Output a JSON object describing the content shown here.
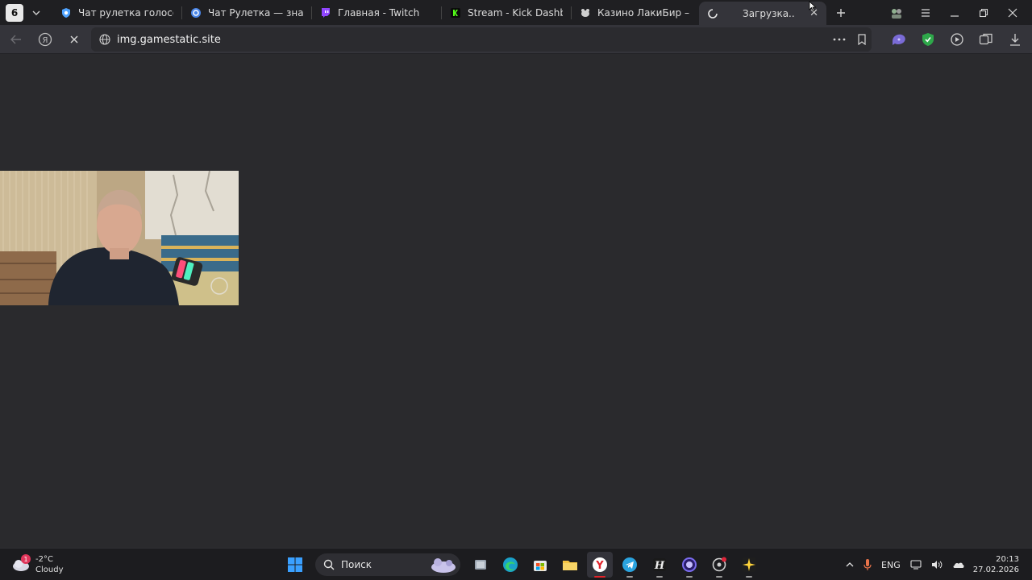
{
  "browser": {
    "tab_count": "6",
    "tabs": [
      {
        "title": "Чат рулетка голосовая -",
        "icon": "roulette-shield-icon",
        "color": "#4fa3ff"
      },
      {
        "title": "Чат Рулетка — знакомст",
        "icon": "roulette-gear-icon",
        "color": "#6aa6ff"
      },
      {
        "title": "Главная - Twitch",
        "icon": "twitch-icon",
        "color": "#9146ff"
      },
      {
        "title": "Stream - Kick Dashboard",
        "icon": "kick-icon",
        "color": "#53fc18"
      },
      {
        "title": "Казино ЛакиБир – Вход",
        "icon": "casino-icon",
        "color": "#cfcfcf"
      },
      {
        "title": "Загрузка...",
        "icon": "loading-spinner-icon",
        "color": "#cfcfcf",
        "active": true
      }
    ],
    "url": "img.gamestatic.site"
  },
  "taskbar": {
    "weather_temp": "-2°C",
    "weather_desc": "Cloudy",
    "weather_badge": "1",
    "search_placeholder": "Поиск",
    "language": "ENG",
    "time": "20:13",
    "date": "27.02.2026"
  },
  "colors": {
    "page_bg": "#2a2a2d",
    "tabstrip_bg": "#1f1f22",
    "toolbar_bg": "#34343a",
    "taskbar_bg": "#1c1c1f"
  }
}
